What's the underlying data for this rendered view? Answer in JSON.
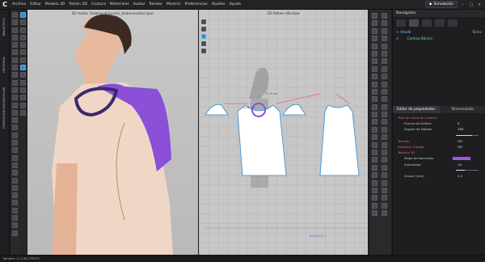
{
  "app": {
    "logo": "C",
    "menu": [
      "Archivo",
      "Editar",
      "Modelo 3D",
      "Patrón 2D",
      "Costura",
      "Materiales",
      "Avatar",
      "Render",
      "Mostrar",
      "Preferencias",
      "Ajustes",
      "Ayuda"
    ],
    "mode": "Simulación"
  },
  "left_strip": [
    "BIBLIOTECA",
    "HISTORIAL",
    "CONFIGURACIÓN RECOLAB"
  ],
  "avatar_window": {
    "title": "3D Avatar (Sobrepublicación_Sobrevestido).zpac"
  },
  "pattern_window": {
    "title": "2D Pattern Window",
    "seam_label_1": "72.9 cm",
    "seam_label_2": "10.2 cm",
    "cursor": "X:0.0 Y:7.1"
  },
  "navigator": {
    "title": "Navegador",
    "add": "+ Añadir",
    "filter": "Todas",
    "item": "Camisa Básica"
  },
  "properties": {
    "tabs": [
      "Editor de propiedades",
      "Sincronizado"
    ],
    "rows": [
      {
        "label": "Tipo de Línea de Costura",
        "kind": "sec"
      },
      {
        "label": "Fuerza de Doblez",
        "value": "0",
        "kind": "sub"
      },
      {
        "label": "Ángulo de Doblez",
        "value": "180",
        "kind": "sub",
        "slider": 0.7
      },
      {
        "label": "",
        "value": "",
        "kind": "gap"
      },
      {
        "label": "Tensión",
        "value": "Off",
        "kind": "sec"
      },
      {
        "label": "Distribuir Simple",
        "value": "Off",
        "kind": "sec"
      },
      {
        "label": "Textura 3D",
        "kind": "sec"
      },
      {
        "label": "Mapa de Normales",
        "value": "",
        "kind": "color"
      },
      {
        "label": "Intensidad",
        "value": "10",
        "kind": "sub",
        "slider": 0.4
      },
      {
        "label": "Grosor (mm)",
        "value": "1.5",
        "kind": "sub"
      }
    ]
  },
  "status": {
    "text": "Tamaño: 11,236 (TRIOP)"
  },
  "colors": {
    "accent": "#2e8fd0",
    "shoulder": "#8b4fd8",
    "skin": "#f0d6c4",
    "seam": "#e46a7d"
  }
}
